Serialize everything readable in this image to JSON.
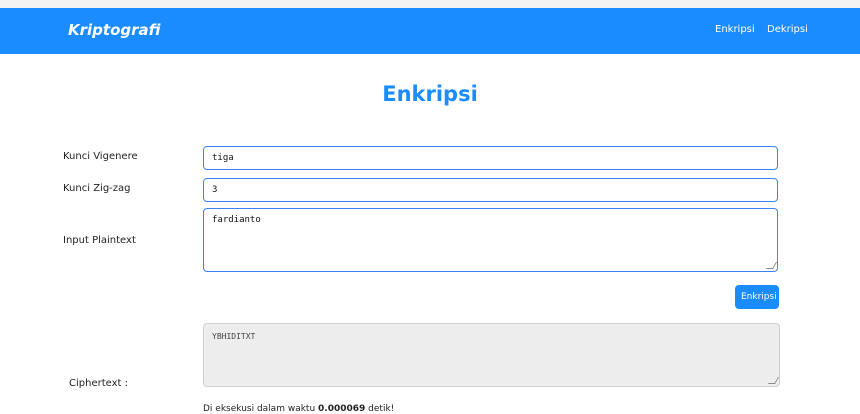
{
  "navbar": {
    "brand": "Kriptografi",
    "links": [
      "Enkripsi",
      "Dekripsi"
    ],
    "background": "#1a8cff"
  },
  "page": {
    "title": "Enkripsi"
  },
  "form": {
    "vigenere_label": "Kunci Vigenere",
    "vigenere_value": "tiga",
    "zigzag_label": "Kunci Zig-zag",
    "zigzag_value": "3",
    "plaintext_label": "Input Plaintext",
    "plaintext_value": "fardianto",
    "submit_label": "Enkripsi",
    "ciphertext_label": "Ciphertext :",
    "ciphertext_value": "YBHIDITXT"
  },
  "execution": {
    "prefix": "Di eksekusi dalam waktu",
    "time": "0.000069",
    "suffix": "detik!"
  }
}
